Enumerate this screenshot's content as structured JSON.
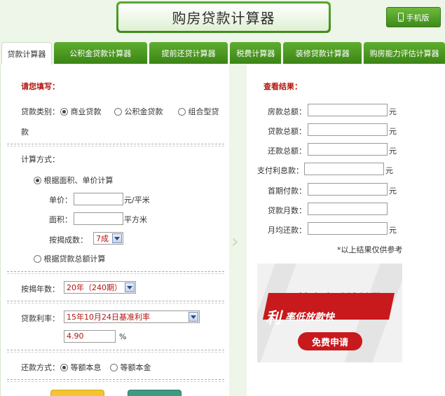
{
  "header": {
    "title": "购房贷款计算器",
    "mobile_label": "手机版"
  },
  "tabs": [
    {
      "label": "贷款计算器",
      "active": true
    },
    {
      "label": "公积金贷款计算器",
      "active": false
    },
    {
      "label": "提前还贷计算器",
      "active": false
    },
    {
      "label": "税费计算器",
      "active": false
    },
    {
      "label": "装修贷款计算器",
      "active": false
    },
    {
      "label": "购房能力评估计算器",
      "active": false
    }
  ],
  "left": {
    "heading": "请您填写：",
    "loan_type_label": "贷款类别：",
    "loan_types": [
      "商业贷款",
      "公积金贷款",
      "组合型贷",
      "款"
    ],
    "calc_method_label": "计算方式：",
    "method_area": "根据面积、单价计算",
    "unit_price_label": "单价：",
    "unit_price_value": "",
    "unit_price_unit": "元/平米",
    "area_label": "面积：",
    "area_value": "",
    "area_unit": "平方米",
    "mortgage_ratio_label": "按揭成数：",
    "mortgage_ratio_value": "7成",
    "method_total": "根据贷款总额计算",
    "years_label": "按揭年数：",
    "years_value": "20年（240期）",
    "rate_label": "贷款利率：",
    "rate_select": "15年10月24日基准利率",
    "rate_value": "4.90",
    "rate_unit": "%",
    "repay_label": "还款方式：",
    "repay_options": [
      "等额本息",
      "等额本金"
    ]
  },
  "right": {
    "heading": "查看结果：",
    "rows": [
      {
        "label": "房款总额：",
        "unit": "元"
      },
      {
        "label": "贷款总额：",
        "unit": "元"
      },
      {
        "label": "还款总额：",
        "unit": "元"
      },
      {
        "label": "支付利息款：",
        "unit": "元"
      },
      {
        "label": "首期付款：",
        "unit": "元"
      },
      {
        "label": "贷款月数：",
        "unit": ""
      },
      {
        "label": "月均还款：",
        "unit": "元"
      }
    ],
    "note": "*以上结果仅供参考"
  },
  "ad": {
    "line1": "搜房金融首付贷",
    "line2a": "利",
    "line2b": "率低放款快",
    "button": "免费申请"
  },
  "colors": {
    "accent_green": "#3f8c1e",
    "heading_red": "#b3160f",
    "ad_red": "#c8191d"
  }
}
